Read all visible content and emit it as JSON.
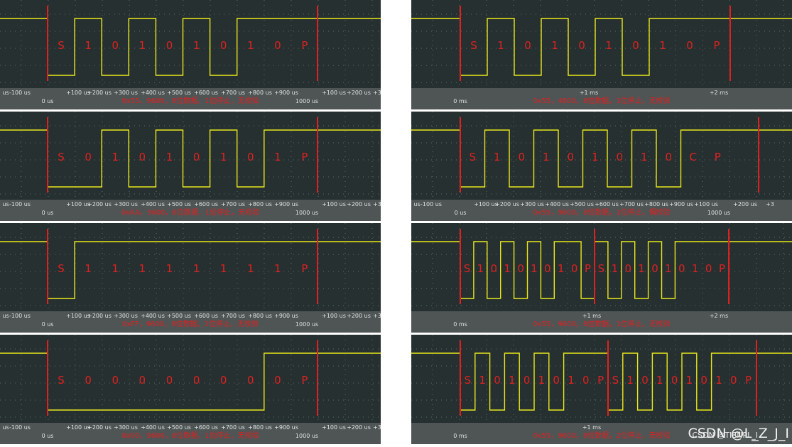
{
  "colors": {
    "trace": "#e8e81c",
    "marker": "#e02020",
    "bit_text": "#e02020",
    "plot_bg": "#273030",
    "grid": "#5a6a6a",
    "axis_bg": "#4f5555",
    "axis_text": "#dde0e0",
    "caption": "#e02020"
  },
  "watermark": {
    "text": "CSDN @L_Z_J_I",
    "small": "CSDN @TIENPL_I"
  },
  "panels": [
    {
      "id": "L1",
      "column": "left",
      "row": 0,
      "caption": "0x55，9600，8位数据，1位停止，无校验",
      "zero_label": "0 us",
      "end_label": "1000 us",
      "ticks": [
        "us",
        "-100 us",
        "+100 us",
        "+200 us",
        "+300 us",
        "+400 us",
        "+500 us",
        "+600 us",
        "+700 us",
        "+800 us",
        "+900 us",
        "+100 us",
        "+200 us",
        "+3"
      ],
      "bits": [
        "S",
        "1",
        "0",
        "1",
        "0",
        "1",
        "0",
        "1",
        "0",
        "P"
      ],
      "levels": [
        1,
        0,
        1,
        0,
        1,
        0,
        1,
        0,
        1,
        1,
        1,
        1
      ]
    },
    {
      "id": "L2",
      "column": "left",
      "row": 1,
      "caption": "0xAA，9600，8位数据，1位停止，无校验",
      "zero_label": "0 us",
      "end_label": "1000 us",
      "ticks": [
        "us",
        "-100 us",
        "+100 us",
        "+200 us",
        "+300 us",
        "+400 us",
        "+500 us",
        "+600 us",
        "+700 us",
        "+800 us",
        "+900 us",
        "+100 us",
        "+200 us",
        "+3"
      ],
      "bits": [
        "S",
        "0",
        "1",
        "0",
        "1",
        "0",
        "1",
        "0",
        "1",
        "P"
      ],
      "levels": [
        1,
        0,
        0,
        1,
        0,
        1,
        0,
        1,
        0,
        1,
        1,
        1
      ]
    },
    {
      "id": "L3",
      "column": "left",
      "row": 2,
      "caption": "0xFF，9600，8位数据，1位停止，无校验",
      "zero_label": "0 us",
      "end_label": "1000 us",
      "ticks": [
        "us",
        "-100 us",
        "+100 us",
        "+200 us",
        "+300 us",
        "+400 us",
        "+500 us",
        "+600 us",
        "+700 us",
        "+800 us",
        "+900 us",
        "+100 us",
        "+200 us",
        "+3"
      ],
      "bits": [
        "S",
        "1",
        "1",
        "1",
        "1",
        "1",
        "1",
        "1",
        "1",
        "P"
      ],
      "levels": [
        1,
        0,
        1,
        1,
        1,
        1,
        1,
        1,
        1,
        1,
        1,
        1
      ]
    },
    {
      "id": "L4",
      "column": "left",
      "row": 3,
      "caption": "0x00，9600，8位数据，1位停止，无校验",
      "zero_label": "0 us",
      "end_label": "1000 us",
      "ticks": [
        "us",
        "-100 us",
        "+100 us",
        "+200 us",
        "+300 us",
        "+400 us",
        "+500 us",
        "+600 us",
        "+700 us",
        "+800 us",
        "+900 us",
        "+100 us",
        "+200 us",
        "+3"
      ],
      "bits": [
        "S",
        "0",
        "0",
        "0",
        "0",
        "0",
        "0",
        "0",
        "0",
        "P"
      ],
      "levels": [
        1,
        0,
        0,
        0,
        0,
        0,
        0,
        0,
        0,
        1,
        1,
        1
      ]
    },
    {
      "id": "R1",
      "column": "right",
      "row": 0,
      "caption": "0x55，4800，8位数据，1位停止，无校验",
      "zero_label": "0 ms",
      "end_label": "",
      "ticks": [
        "+1 ms",
        "+2 ms"
      ],
      "bits": [
        "S",
        "1",
        "0",
        "1",
        "0",
        "1",
        "0",
        "1",
        "0",
        "P"
      ],
      "levels": [
        1,
        0,
        1,
        0,
        1,
        0,
        1,
        0,
        1,
        1,
        1,
        1
      ]
    },
    {
      "id": "R2",
      "column": "right",
      "row": 1,
      "caption": "0x55，9600，8位数据，1位停止，偶校验",
      "zero_label": "0 us",
      "end_label": "1000 us",
      "ticks": [
        "us",
        "-100 us",
        "+100 us",
        "+200 us",
        "+300 us",
        "+400 us",
        "+500 us",
        "+600 us",
        "+700 us",
        "+800 us",
        "+900 us",
        "+100 us",
        "+200 us",
        "+3"
      ],
      "bits": [
        "S",
        "1",
        "0",
        "1",
        "0",
        "1",
        "0",
        "1",
        "0",
        "C",
        "P"
      ],
      "levels": [
        1,
        0,
        1,
        0,
        1,
        0,
        1,
        0,
        1,
        0,
        1,
        1,
        1
      ]
    },
    {
      "id": "R3",
      "column": "right",
      "row": 2,
      "caption": "0x55，9600，8位数据，1位停止，无校验",
      "zero_label": "0 ms",
      "end_label": "",
      "ticks": [
        "+1 ms",
        "+2 ms"
      ],
      "bits": [
        "S",
        "1",
        "0",
        "1",
        "0",
        "1",
        "0",
        "1",
        "0",
        "P",
        "S",
        "1",
        "0",
        "1",
        "0",
        "1",
        "0",
        "1",
        "0",
        "P"
      ],
      "levels": [
        1,
        0,
        1,
        0,
        1,
        0,
        1,
        0,
        1,
        1,
        0,
        1,
        0,
        1,
        0,
        1,
        0,
        1,
        1,
        1
      ]
    },
    {
      "id": "R4",
      "column": "right",
      "row": 3,
      "caption": "0x55，9600，8位数据，2位停止，无校验",
      "zero_label": "0 ms",
      "end_label": "",
      "ticks": [
        "+1 ms"
      ],
      "bits": [
        "S",
        "1",
        "0",
        "1",
        "0",
        "1",
        "0",
        "1",
        "0",
        "P",
        "S",
        "1",
        "0",
        "1",
        "0",
        "1",
        "0",
        "1",
        "0",
        "P"
      ],
      "levels": [
        1,
        0,
        1,
        0,
        1,
        0,
        1,
        0,
        1,
        1,
        1,
        0,
        1,
        0,
        1,
        0,
        1,
        0,
        1,
        1,
        1,
        1
      ]
    }
  ]
}
